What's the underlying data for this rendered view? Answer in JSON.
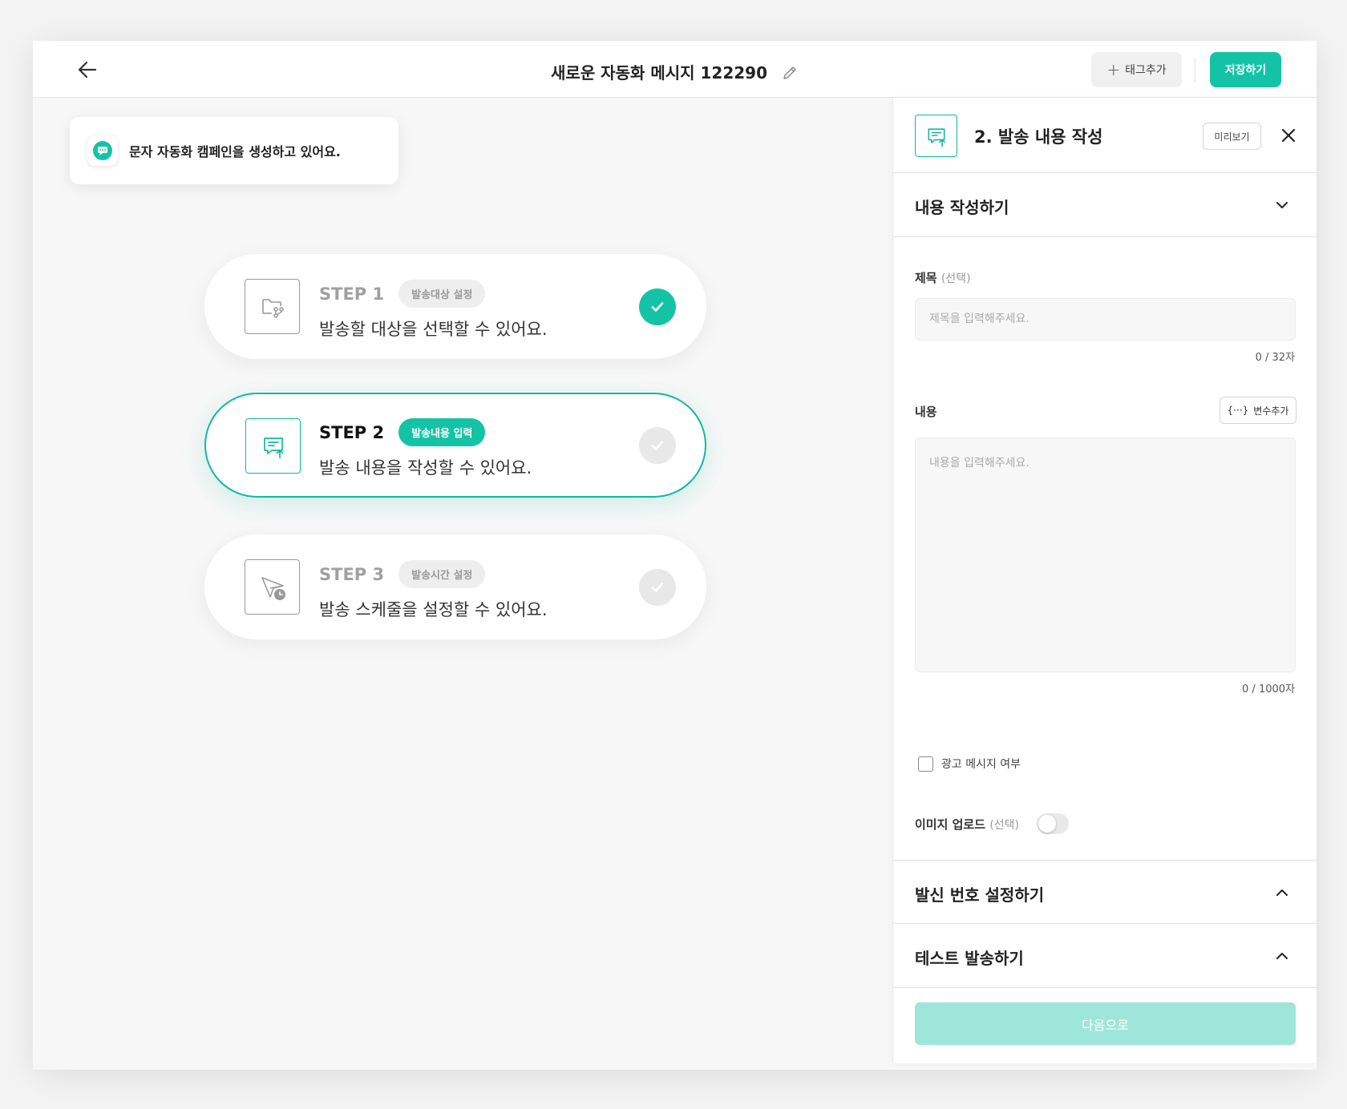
{
  "header": {
    "title": "새로운 자동화 메시지 122290",
    "tag_button": "태그추가",
    "save_button": "저장하기"
  },
  "toast": {
    "text": "문자 자동화 캠페인을 생성하고 있어요."
  },
  "steps": [
    {
      "label": "STEP 1",
      "pill": "발송대상 설정",
      "desc": "발송할 대상을 선택할 수 있어요.",
      "state": "done"
    },
    {
      "label": "STEP 2",
      "pill": "발송내용 입력",
      "desc": "발송 내용을 작성할 수 있어요.",
      "state": "active"
    },
    {
      "label": "STEP 3",
      "pill": "발송시간 설정",
      "desc": "발송 스케줄을 설정할 수 있어요.",
      "state": "pending"
    }
  ],
  "panel": {
    "title": "2. 발송 내용 작성",
    "preview_button": "미리보기",
    "section_content": "내용 작성하기",
    "subject_label": "제목",
    "subject_optional": "(선택)",
    "subject_placeholder": "제목을 입력해주세요.",
    "subject_counter": "0 / 32자",
    "body_label": "내용",
    "variable_button": "변수추가",
    "body_placeholder": "내용을 입력해주세요.",
    "body_counter": "0 / 1000자",
    "ad_checkbox": "광고 메시지 여부",
    "image_upload_label": "이미지 업로드",
    "image_upload_optional": "(선택)",
    "section_sender": "발신 번호 설정하기",
    "section_test": "테스트 발송하기",
    "next_button": "다음으로"
  },
  "colors": {
    "accent": "#14c3a6",
    "accent_disabled": "#9ee6d9"
  }
}
